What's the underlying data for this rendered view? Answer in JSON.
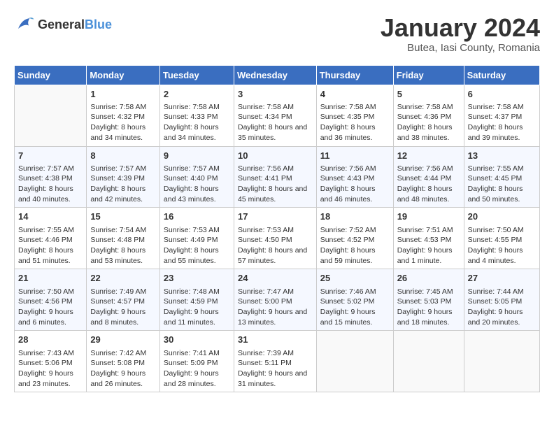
{
  "header": {
    "logo_general": "General",
    "logo_blue": "Blue",
    "month_title": "January 2024",
    "subtitle": "Butea, Iasi County, Romania"
  },
  "calendar": {
    "headers": [
      "Sunday",
      "Monday",
      "Tuesday",
      "Wednesday",
      "Thursday",
      "Friday",
      "Saturday"
    ],
    "weeks": [
      [
        {
          "day": "",
          "sunrise": "",
          "sunset": "",
          "daylight": ""
        },
        {
          "day": "1",
          "sunrise": "Sunrise: 7:58 AM",
          "sunset": "Sunset: 4:32 PM",
          "daylight": "Daylight: 8 hours and 34 minutes."
        },
        {
          "day": "2",
          "sunrise": "Sunrise: 7:58 AM",
          "sunset": "Sunset: 4:33 PM",
          "daylight": "Daylight: 8 hours and 34 minutes."
        },
        {
          "day": "3",
          "sunrise": "Sunrise: 7:58 AM",
          "sunset": "Sunset: 4:34 PM",
          "daylight": "Daylight: 8 hours and 35 minutes."
        },
        {
          "day": "4",
          "sunrise": "Sunrise: 7:58 AM",
          "sunset": "Sunset: 4:35 PM",
          "daylight": "Daylight: 8 hours and 36 minutes."
        },
        {
          "day": "5",
          "sunrise": "Sunrise: 7:58 AM",
          "sunset": "Sunset: 4:36 PM",
          "daylight": "Daylight: 8 hours and 38 minutes."
        },
        {
          "day": "6",
          "sunrise": "Sunrise: 7:58 AM",
          "sunset": "Sunset: 4:37 PM",
          "daylight": "Daylight: 8 hours and 39 minutes."
        }
      ],
      [
        {
          "day": "7",
          "sunrise": "Sunrise: 7:57 AM",
          "sunset": "Sunset: 4:38 PM",
          "daylight": "Daylight: 8 hours and 40 minutes."
        },
        {
          "day": "8",
          "sunrise": "Sunrise: 7:57 AM",
          "sunset": "Sunset: 4:39 PM",
          "daylight": "Daylight: 8 hours and 42 minutes."
        },
        {
          "day": "9",
          "sunrise": "Sunrise: 7:57 AM",
          "sunset": "Sunset: 4:40 PM",
          "daylight": "Daylight: 8 hours and 43 minutes."
        },
        {
          "day": "10",
          "sunrise": "Sunrise: 7:56 AM",
          "sunset": "Sunset: 4:41 PM",
          "daylight": "Daylight: 8 hours and 45 minutes."
        },
        {
          "day": "11",
          "sunrise": "Sunrise: 7:56 AM",
          "sunset": "Sunset: 4:43 PM",
          "daylight": "Daylight: 8 hours and 46 minutes."
        },
        {
          "day": "12",
          "sunrise": "Sunrise: 7:56 AM",
          "sunset": "Sunset: 4:44 PM",
          "daylight": "Daylight: 8 hours and 48 minutes."
        },
        {
          "day": "13",
          "sunrise": "Sunrise: 7:55 AM",
          "sunset": "Sunset: 4:45 PM",
          "daylight": "Daylight: 8 hours and 50 minutes."
        }
      ],
      [
        {
          "day": "14",
          "sunrise": "Sunrise: 7:55 AM",
          "sunset": "Sunset: 4:46 PM",
          "daylight": "Daylight: 8 hours and 51 minutes."
        },
        {
          "day": "15",
          "sunrise": "Sunrise: 7:54 AM",
          "sunset": "Sunset: 4:48 PM",
          "daylight": "Daylight: 8 hours and 53 minutes."
        },
        {
          "day": "16",
          "sunrise": "Sunrise: 7:53 AM",
          "sunset": "Sunset: 4:49 PM",
          "daylight": "Daylight: 8 hours and 55 minutes."
        },
        {
          "day": "17",
          "sunrise": "Sunrise: 7:53 AM",
          "sunset": "Sunset: 4:50 PM",
          "daylight": "Daylight: 8 hours and 57 minutes."
        },
        {
          "day": "18",
          "sunrise": "Sunrise: 7:52 AM",
          "sunset": "Sunset: 4:52 PM",
          "daylight": "Daylight: 8 hours and 59 minutes."
        },
        {
          "day": "19",
          "sunrise": "Sunrise: 7:51 AM",
          "sunset": "Sunset: 4:53 PM",
          "daylight": "Daylight: 9 hours and 1 minute."
        },
        {
          "day": "20",
          "sunrise": "Sunrise: 7:50 AM",
          "sunset": "Sunset: 4:55 PM",
          "daylight": "Daylight: 9 hours and 4 minutes."
        }
      ],
      [
        {
          "day": "21",
          "sunrise": "Sunrise: 7:50 AM",
          "sunset": "Sunset: 4:56 PM",
          "daylight": "Daylight: 9 hours and 6 minutes."
        },
        {
          "day": "22",
          "sunrise": "Sunrise: 7:49 AM",
          "sunset": "Sunset: 4:57 PM",
          "daylight": "Daylight: 9 hours and 8 minutes."
        },
        {
          "day": "23",
          "sunrise": "Sunrise: 7:48 AM",
          "sunset": "Sunset: 4:59 PM",
          "daylight": "Daylight: 9 hours and 11 minutes."
        },
        {
          "day": "24",
          "sunrise": "Sunrise: 7:47 AM",
          "sunset": "Sunset: 5:00 PM",
          "daylight": "Daylight: 9 hours and 13 minutes."
        },
        {
          "day": "25",
          "sunrise": "Sunrise: 7:46 AM",
          "sunset": "Sunset: 5:02 PM",
          "daylight": "Daylight: 9 hours and 15 minutes."
        },
        {
          "day": "26",
          "sunrise": "Sunrise: 7:45 AM",
          "sunset": "Sunset: 5:03 PM",
          "daylight": "Daylight: 9 hours and 18 minutes."
        },
        {
          "day": "27",
          "sunrise": "Sunrise: 7:44 AM",
          "sunset": "Sunset: 5:05 PM",
          "daylight": "Daylight: 9 hours and 20 minutes."
        }
      ],
      [
        {
          "day": "28",
          "sunrise": "Sunrise: 7:43 AM",
          "sunset": "Sunset: 5:06 PM",
          "daylight": "Daylight: 9 hours and 23 minutes."
        },
        {
          "day": "29",
          "sunrise": "Sunrise: 7:42 AM",
          "sunset": "Sunset: 5:08 PM",
          "daylight": "Daylight: 9 hours and 26 minutes."
        },
        {
          "day": "30",
          "sunrise": "Sunrise: 7:41 AM",
          "sunset": "Sunset: 5:09 PM",
          "daylight": "Daylight: 9 hours and 28 minutes."
        },
        {
          "day": "31",
          "sunrise": "Sunrise: 7:39 AM",
          "sunset": "Sunset: 5:11 PM",
          "daylight": "Daylight: 9 hours and 31 minutes."
        },
        {
          "day": "",
          "sunrise": "",
          "sunset": "",
          "daylight": ""
        },
        {
          "day": "",
          "sunrise": "",
          "sunset": "",
          "daylight": ""
        },
        {
          "day": "",
          "sunrise": "",
          "sunset": "",
          "daylight": ""
        }
      ]
    ]
  }
}
